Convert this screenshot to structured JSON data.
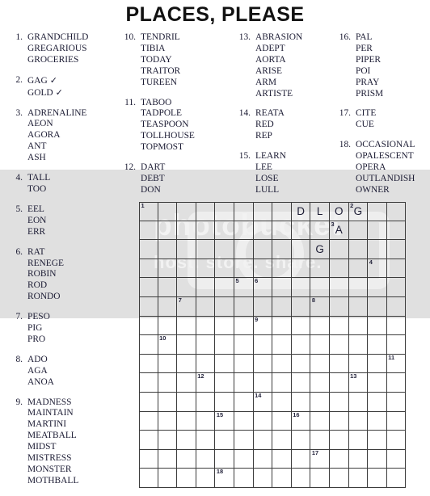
{
  "page": {
    "title": "PLACES, PLEASE"
  },
  "watermark": {
    "line1": "photobucket",
    "line2": "host. store. share."
  },
  "wordlist": {
    "columns": [
      {
        "groups": [
          {
            "number": "1.",
            "words": [
              {
                "text": "GRANDCHILD",
                "check": false
              },
              {
                "text": "GREGARIOUS",
                "check": false
              },
              {
                "text": "GROCERIES",
                "check": false
              }
            ]
          },
          {
            "number": "2.",
            "words": [
              {
                "text": "GAG",
                "check": true
              },
              {
                "text": "GOLD",
                "check": true
              }
            ]
          },
          {
            "number": "3.",
            "words": [
              {
                "text": "ADRENALINE",
                "check": false
              },
              {
                "text": "AEON",
                "check": false
              },
              {
                "text": "AGORA",
                "check": false
              },
              {
                "text": "ANT",
                "check": false
              },
              {
                "text": "ASH",
                "check": false
              }
            ]
          },
          {
            "number": "4.",
            "words": [
              {
                "text": "TALL",
                "check": false
              },
              {
                "text": "TOO",
                "check": false
              }
            ]
          },
          {
            "number": "5.",
            "words": [
              {
                "text": "EEL",
                "check": false
              },
              {
                "text": "EON",
                "check": false
              },
              {
                "text": "ERR",
                "check": false
              }
            ]
          },
          {
            "number": "6.",
            "words": [
              {
                "text": "RAT",
                "check": false
              },
              {
                "text": "RENEGE",
                "check": false
              },
              {
                "text": "ROBIN",
                "check": false
              },
              {
                "text": "ROD",
                "check": false
              },
              {
                "text": "RONDO",
                "check": false
              }
            ]
          },
          {
            "number": "7.",
            "words": [
              {
                "text": "PESO",
                "check": false
              },
              {
                "text": "PIG",
                "check": false
              },
              {
                "text": "PRO",
                "check": false
              }
            ]
          },
          {
            "number": "8.",
            "words": [
              {
                "text": "ADO",
                "check": false
              },
              {
                "text": "AGA",
                "check": false
              },
              {
                "text": "ANOA",
                "check": false
              }
            ]
          },
          {
            "number": "9.",
            "words": [
              {
                "text": "MADNESS",
                "check": false
              },
              {
                "text": "MAINTAIN",
                "check": false
              },
              {
                "text": "MARTINI",
                "check": false
              },
              {
                "text": "MEATBALL",
                "check": false
              },
              {
                "text": "MIDST",
                "check": false
              },
              {
                "text": "MISTRESS",
                "check": false
              },
              {
                "text": "MONSTER",
                "check": false
              },
              {
                "text": "MOTHBALL",
                "check": false
              }
            ]
          }
        ]
      },
      {
        "groups": [
          {
            "number": "10.",
            "words": [
              {
                "text": "TENDRIL",
                "check": false
              },
              {
                "text": "TIBIA",
                "check": false
              },
              {
                "text": "TODAY",
                "check": false
              },
              {
                "text": "TRAITOR",
                "check": false
              },
              {
                "text": "TUREEN",
                "check": false
              }
            ]
          },
          {
            "number": "11.",
            "words": [
              {
                "text": "TABOO",
                "check": false
              },
              {
                "text": "TADPOLE",
                "check": false
              },
              {
                "text": "TEASPOON",
                "check": false
              },
              {
                "text": "TOLLHOUSE",
                "check": false
              },
              {
                "text": "TOPMOST",
                "check": false
              }
            ]
          },
          {
            "number": "12.",
            "words": [
              {
                "text": "DART",
                "check": false
              },
              {
                "text": "DEBT",
                "check": false
              },
              {
                "text": "DON",
                "check": false
              }
            ]
          }
        ]
      },
      {
        "groups": [
          {
            "number": "13.",
            "words": [
              {
                "text": "ABRASION",
                "check": false
              },
              {
                "text": "ADEPT",
                "check": false
              },
              {
                "text": "AORTA",
                "check": false
              },
              {
                "text": "ARISE",
                "check": false
              },
              {
                "text": "ARM",
                "check": false
              },
              {
                "text": "ARTISTE",
                "check": false
              }
            ]
          },
          {
            "number": "14.",
            "words": [
              {
                "text": "REATA",
                "check": false
              },
              {
                "text": "RED",
                "check": false
              },
              {
                "text": "REP",
                "check": false
              }
            ]
          },
          {
            "number": "15.",
            "words": [
              {
                "text": "LEARN",
                "check": false
              },
              {
                "text": "LEE",
                "check": false
              },
              {
                "text": "LOSE",
                "check": false
              },
              {
                "text": "LULL",
                "check": false
              }
            ]
          }
        ]
      },
      {
        "groups": [
          {
            "number": "16.",
            "words": [
              {
                "text": "PAL",
                "check": false
              },
              {
                "text": "PER",
                "check": false
              },
              {
                "text": "PIPER",
                "check": false
              },
              {
                "text": "POI",
                "check": false
              },
              {
                "text": "PRAY",
                "check": false
              },
              {
                "text": "PRISM",
                "check": false
              }
            ]
          },
          {
            "number": "17.",
            "words": [
              {
                "text": "CITE",
                "check": false
              },
              {
                "text": "CUE",
                "check": false
              }
            ]
          },
          {
            "number": "18.",
            "words": [
              {
                "text": "OCCASIONAL",
                "check": false
              },
              {
                "text": "OPALESCENT",
                "check": false
              },
              {
                "text": "OPERA",
                "check": false
              },
              {
                "text": "OUTLANDISH",
                "check": false
              },
              {
                "text": "OWNER",
                "check": false
              }
            ]
          }
        ]
      }
    ],
    "check_glyph": "✓"
  },
  "grid": {
    "rows": 15,
    "cols": 14,
    "numbers": [
      {
        "n": "1",
        "r": 0,
        "c": 0
      },
      {
        "n": "2",
        "r": 0,
        "c": 11
      },
      {
        "n": "3",
        "r": 1,
        "c": 10
      },
      {
        "n": "4",
        "r": 3,
        "c": 12
      },
      {
        "n": "5",
        "r": 4,
        "c": 5
      },
      {
        "n": "6",
        "r": 4,
        "c": 6
      },
      {
        "n": "7",
        "r": 5,
        "c": 2
      },
      {
        "n": "8",
        "r": 5,
        "c": 9
      },
      {
        "n": "9",
        "r": 6,
        "c": 6
      },
      {
        "n": "10",
        "r": 7,
        "c": 1
      },
      {
        "n": "11",
        "r": 8,
        "c": 13
      },
      {
        "n": "12",
        "r": 9,
        "c": 3
      },
      {
        "n": "13",
        "r": 9,
        "c": 11
      },
      {
        "n": "14",
        "r": 10,
        "c": 6
      },
      {
        "n": "15",
        "r": 11,
        "c": 4
      },
      {
        "n": "16",
        "r": 11,
        "c": 8
      },
      {
        "n": "17",
        "r": 13,
        "c": 9
      },
      {
        "n": "18",
        "r": 14,
        "c": 4
      }
    ],
    "letters": [
      {
        "ch": "D",
        "r": 0,
        "c": 8
      },
      {
        "ch": "L",
        "r": 0,
        "c": 9
      },
      {
        "ch": "O",
        "r": 0,
        "c": 10
      },
      {
        "ch": "G",
        "r": 0,
        "c": 11
      },
      {
        "ch": "A",
        "r": 1,
        "c": 10
      },
      {
        "ch": "G",
        "r": 2,
        "c": 9
      }
    ]
  }
}
